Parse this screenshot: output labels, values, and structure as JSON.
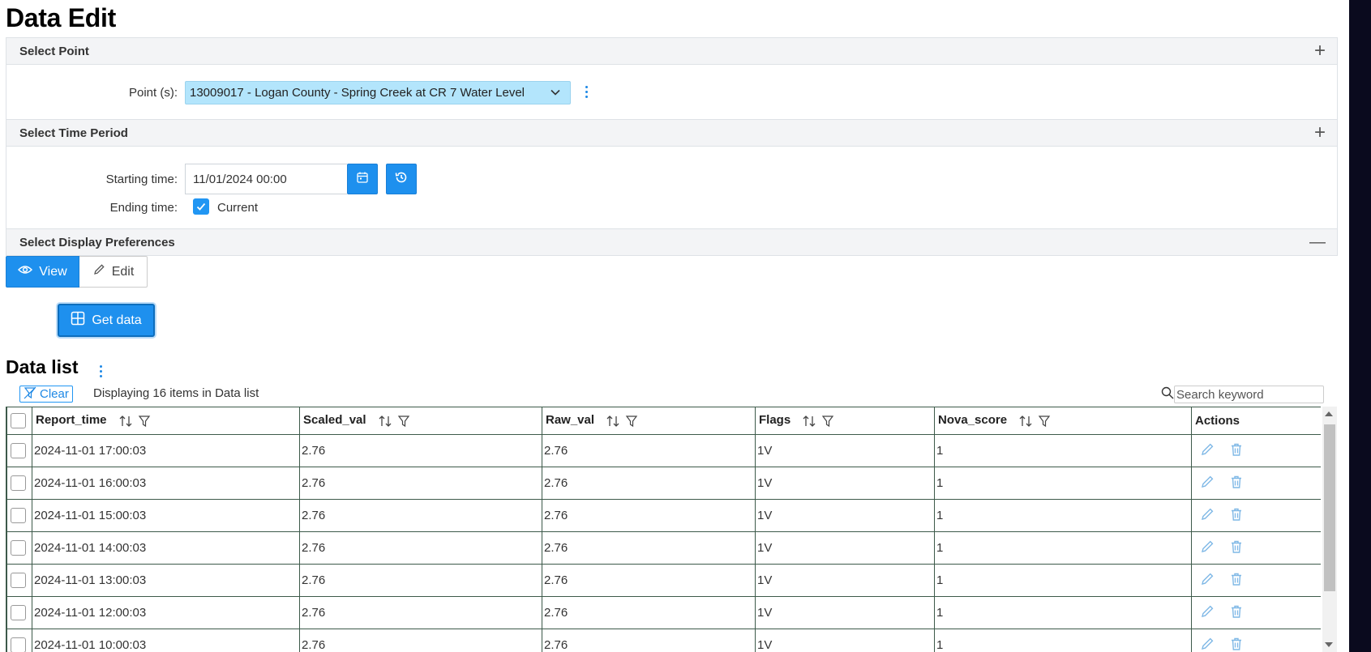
{
  "page": {
    "title": "Data Edit"
  },
  "select_point": {
    "header": "Select Point",
    "toggle": "+",
    "label": "Point (s):",
    "selected": "13009017 - Logan County - Spring Creek at CR 7 Water Level"
  },
  "select_time": {
    "header": "Select Time Period",
    "toggle": "+",
    "starting_label": "Starting time:",
    "starting_value": "11/01/2024 00:00",
    "ending_label": "Ending time:",
    "current_label": "Current",
    "current_checked": true
  },
  "display_prefs": {
    "header": "Select Display Preferences",
    "toggle": "—",
    "view_label": "View",
    "edit_label": "Edit",
    "active_mode": "View"
  },
  "get_data": {
    "label": "Get data"
  },
  "data_list": {
    "title": "Data list",
    "clear_label": "Clear",
    "displaying": "Displaying 16 items in Data list",
    "search_placeholder": "Search keyword",
    "columns": [
      "Report_time",
      "Scaled_val",
      "Raw_val",
      "Flags",
      "Nova_score",
      "Actions"
    ],
    "rows": [
      [
        "2024-11-01 17:00:03",
        "2.76",
        "2.76",
        "1V",
        "1"
      ],
      [
        "2024-11-01 16:00:03",
        "2.76",
        "2.76",
        "1V",
        "1"
      ],
      [
        "2024-11-01 15:00:03",
        "2.76",
        "2.76",
        "1V",
        "1"
      ],
      [
        "2024-11-01 14:00:03",
        "2.76",
        "2.76",
        "1V",
        "1"
      ],
      [
        "2024-11-01 13:00:03",
        "2.76",
        "2.76",
        "1V",
        "1"
      ],
      [
        "2024-11-01 12:00:03",
        "2.76",
        "2.76",
        "1V",
        "1"
      ],
      [
        "2024-11-01 10:00:03",
        "2.76",
        "2.76",
        "1V",
        "1"
      ]
    ]
  },
  "colors": {
    "accent": "#1e90ee",
    "point_select_bg": "#b3e5fc",
    "header_bg": "#f3f4f6",
    "table_border": "#3d5a4a"
  }
}
